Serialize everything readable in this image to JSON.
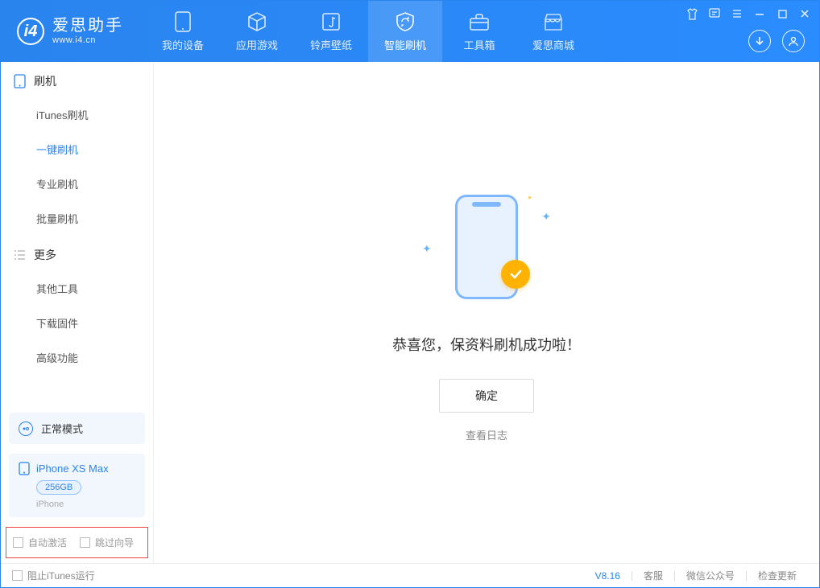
{
  "app": {
    "title": "爱思助手",
    "subtitle": "www.i4.cn"
  },
  "tabs": [
    {
      "label": "我的设备"
    },
    {
      "label": "应用游戏"
    },
    {
      "label": "铃声壁纸"
    },
    {
      "label": "智能刷机"
    },
    {
      "label": "工具箱"
    },
    {
      "label": "爱思商城"
    }
  ],
  "sidebar": {
    "section1_title": "刷机",
    "items1": [
      "iTunes刷机",
      "一键刷机",
      "专业刷机",
      "批量刷机"
    ],
    "section2_title": "更多",
    "items2": [
      "其他工具",
      "下载固件",
      "高级功能"
    ]
  },
  "mode": {
    "label": "正常模式"
  },
  "device": {
    "name": "iPhone XS Max",
    "capacity": "256GB",
    "type": "iPhone"
  },
  "checkboxes": {
    "auto_activate": "自动激活",
    "skip_guide": "跳过向导"
  },
  "main": {
    "success": "恭喜您，保资料刷机成功啦！",
    "ok": "确定",
    "view_log": "查看日志"
  },
  "footer": {
    "block_itunes": "阻止iTunes运行",
    "version": "V8.16",
    "service": "客服",
    "wechat": "微信公众号",
    "update": "检查更新"
  }
}
